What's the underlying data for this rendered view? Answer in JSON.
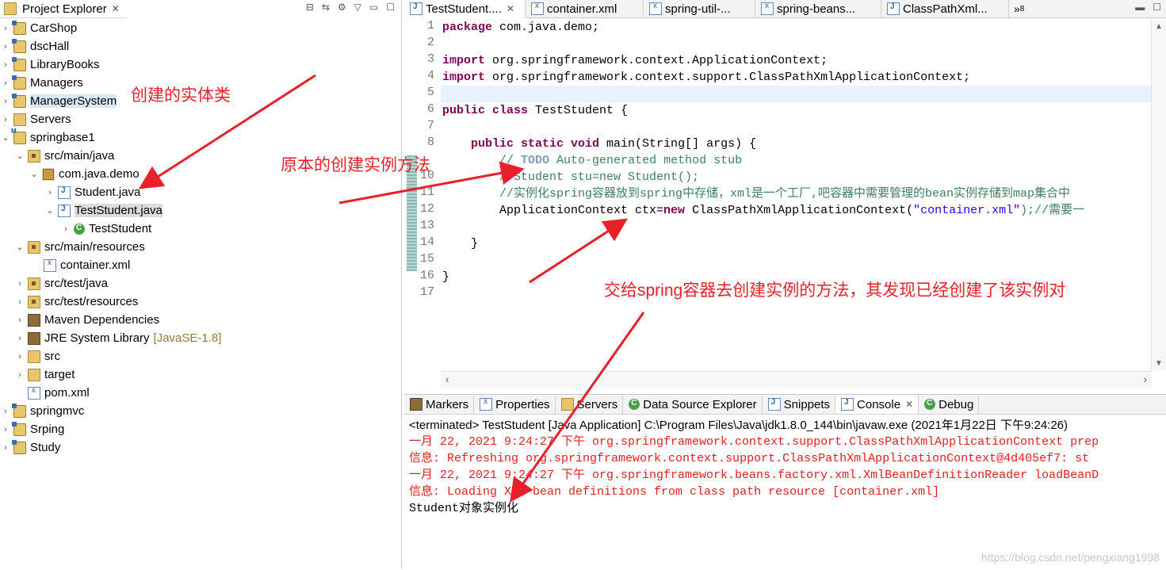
{
  "explorer": {
    "tab_label": "Project Explorer",
    "items": [
      {
        "label": "CarShop",
        "extra": ""
      },
      {
        "label": "dscHall",
        "extra": ""
      },
      {
        "label": "LibraryBooks",
        "extra": ""
      },
      {
        "label": "Managers",
        "extra": ""
      },
      {
        "label": "ManagerSystem",
        "extra": ""
      },
      {
        "label": "Servers",
        "extra": ""
      },
      {
        "label": "springbase1",
        "extra": ""
      },
      {
        "label": "src/main/java",
        "extra": ""
      },
      {
        "label": "com.java.demo",
        "extra": ""
      },
      {
        "label": "Student.java",
        "extra": ""
      },
      {
        "label": "TestStudent.java",
        "extra": ""
      },
      {
        "label": "TestStudent",
        "extra": ""
      },
      {
        "label": "src/main/resources",
        "extra": ""
      },
      {
        "label": "container.xml",
        "extra": ""
      },
      {
        "label": "src/test/java",
        "extra": ""
      },
      {
        "label": "src/test/resources",
        "extra": ""
      },
      {
        "label": "Maven Dependencies",
        "extra": ""
      },
      {
        "label": "JRE System Library",
        "extra": "[JavaSE-1.8]"
      },
      {
        "label": "src",
        "extra": ""
      },
      {
        "label": "target",
        "extra": ""
      },
      {
        "label": "pom.xml",
        "extra": ""
      },
      {
        "label": "springmvc",
        "extra": ""
      },
      {
        "label": "Srping",
        "extra": ""
      },
      {
        "label": "Study",
        "extra": ""
      }
    ]
  },
  "editor": {
    "tabs": [
      {
        "label": "TestStudent...."
      },
      {
        "label": "container.xml"
      },
      {
        "label": "spring-util-..."
      },
      {
        "label": "spring-beans..."
      },
      {
        "label": "ClassPathXml..."
      }
    ],
    "overflow_count": "8",
    "line_numbers": [
      "1",
      "2",
      "3",
      "4",
      "5",
      "6",
      "7",
      "8",
      "10",
      "11",
      "12",
      "13",
      "14",
      "15",
      "16",
      "17"
    ],
    "code": {
      "l1_kw": "package",
      "l1_rest": " com.java.demo;",
      "l3_kw": "import",
      "l3_rest": " org.springframework.context.ApplicationContext;",
      "l4_kw": "import",
      "l4_rest": " org.springframework.context.support.ClassPathXmlApplicationContext;",
      "l6_kw": "public class",
      "l6_rest": " TestStudent {",
      "l8_indent": "    ",
      "l8_kw": "public static void",
      "l8_rest": " main(String[] args) {",
      "l9_c1": "        // ",
      "l9_todo": "TODO",
      "l9_c2": " Auto-generated method stub",
      "l10": "        //Student stu=new Student();",
      "l11": "        //实例化spring容器放到spring中存储，xml是一个工厂,吧容器中需要管理的bean实例存储到map集合中",
      "l12_a": "        ApplicationContext ctx=",
      "l12_kw": "new",
      "l12_b": " ClassPathXmlApplicationContext(",
      "l12_str": "\"container.xml\"",
      "l12_c": ");//需要一",
      "l14": "    }",
      "l16": "}"
    }
  },
  "console": {
    "tabs": [
      {
        "label": "Markers"
      },
      {
        "label": "Properties"
      },
      {
        "label": "Servers"
      },
      {
        "label": "Data Source Explorer"
      },
      {
        "label": "Snippets"
      },
      {
        "label": "Console"
      },
      {
        "label": "Debug"
      }
    ],
    "header": "<terminated> TestStudent [Java Application] C:\\Program Files\\Java\\jdk1.8.0_144\\bin\\javaw.exe (2021年1月22日 下午9:24:26)",
    "lines": [
      "一月 22, 2021 9:24:27 下午 org.springframework.context.support.ClassPathXmlApplicationContext prep",
      "信息: Refreshing org.springframework.context.support.ClassPathXmlApplicationContext@4d405ef7: st",
      "一月 22, 2021 9:24:27 下午 org.springframework.beans.factory.xml.XmlBeanDefinitionReader loadBeanD",
      "信息: Loading XML bean definitions from class path resource [container.xml]",
      "Student对象实例化"
    ],
    "watermark": "https://blog.csdn.net/pengxiang1998"
  },
  "annotations": {
    "entity": "创建的实体类",
    "original": "原本的创建实例方法",
    "spring": "交给spring容器去创建实例的方法，其发现已经创建了该实例对"
  },
  "colors": {
    "annotation": "#e8202a",
    "keyword": "#7f0055",
    "comment": "#3f7f5f",
    "string": "#2a00ff",
    "console_red": "#e02020"
  }
}
